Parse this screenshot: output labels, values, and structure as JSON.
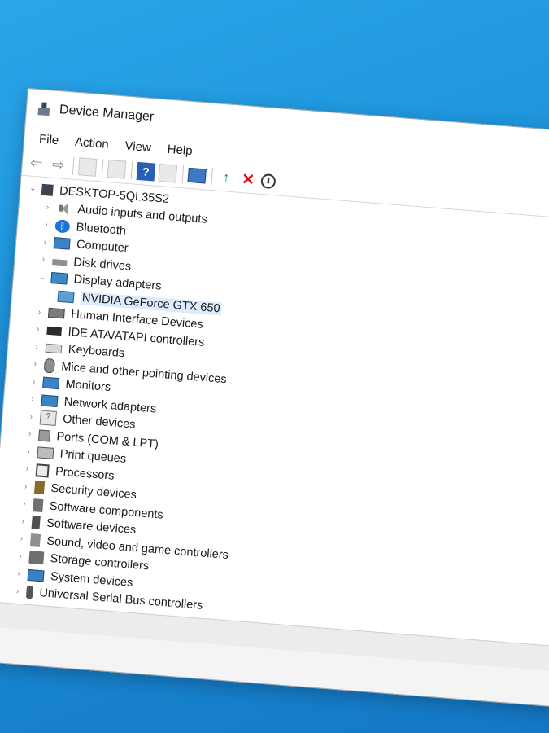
{
  "window": {
    "title": "Device Manager"
  },
  "menu": [
    "File",
    "Action",
    "View",
    "Help"
  ],
  "toolbar": {
    "help_label": "?",
    "red_x_label": "✕",
    "down_label": "⬇",
    "green_label": "↑"
  },
  "tree": {
    "root": "DESKTOP-5QL35S2",
    "items": [
      {
        "label": "Audio inputs and outputs",
        "icon": "speaker-icon"
      },
      {
        "label": "Bluetooth",
        "icon": "bluetooth-icon"
      },
      {
        "label": "Computer",
        "icon": "monitor-icon"
      },
      {
        "label": "Disk drives",
        "icon": "disk-icon"
      },
      {
        "label": "Display adapters",
        "icon": "display-adapter-icon",
        "expanded": true,
        "children": [
          {
            "label": "NVIDIA GeForce GTX 650",
            "icon": "gpu-icon"
          }
        ]
      },
      {
        "label": "Human Interface Devices",
        "icon": "hid-icon"
      },
      {
        "label": "IDE ATA/ATAPI controllers",
        "icon": "ide-icon"
      },
      {
        "label": "Keyboards",
        "icon": "keyboard-icon"
      },
      {
        "label": "Mice and other pointing devices",
        "icon": "mouse-icon"
      },
      {
        "label": "Monitors",
        "icon": "monitor-icon"
      },
      {
        "label": "Network adapters",
        "icon": "network-icon"
      },
      {
        "label": "Other devices",
        "icon": "other-devices-icon"
      },
      {
        "label": "Ports (COM & LPT)",
        "icon": "ports-icon"
      },
      {
        "label": "Print queues",
        "icon": "printer-icon"
      },
      {
        "label": "Processors",
        "icon": "processor-icon"
      },
      {
        "label": "Security devices",
        "icon": "security-icon"
      },
      {
        "label": "Software components",
        "icon": "software-components-icon"
      },
      {
        "label": "Software devices",
        "icon": "software-devices-icon"
      },
      {
        "label": "Sound, video and game controllers",
        "icon": "sound-icon"
      },
      {
        "label": "Storage controllers",
        "icon": "storage-icon"
      },
      {
        "label": "System devices",
        "icon": "system-icon"
      },
      {
        "label": "Universal Serial Bus controllers",
        "icon": "usb-icon"
      }
    ]
  }
}
